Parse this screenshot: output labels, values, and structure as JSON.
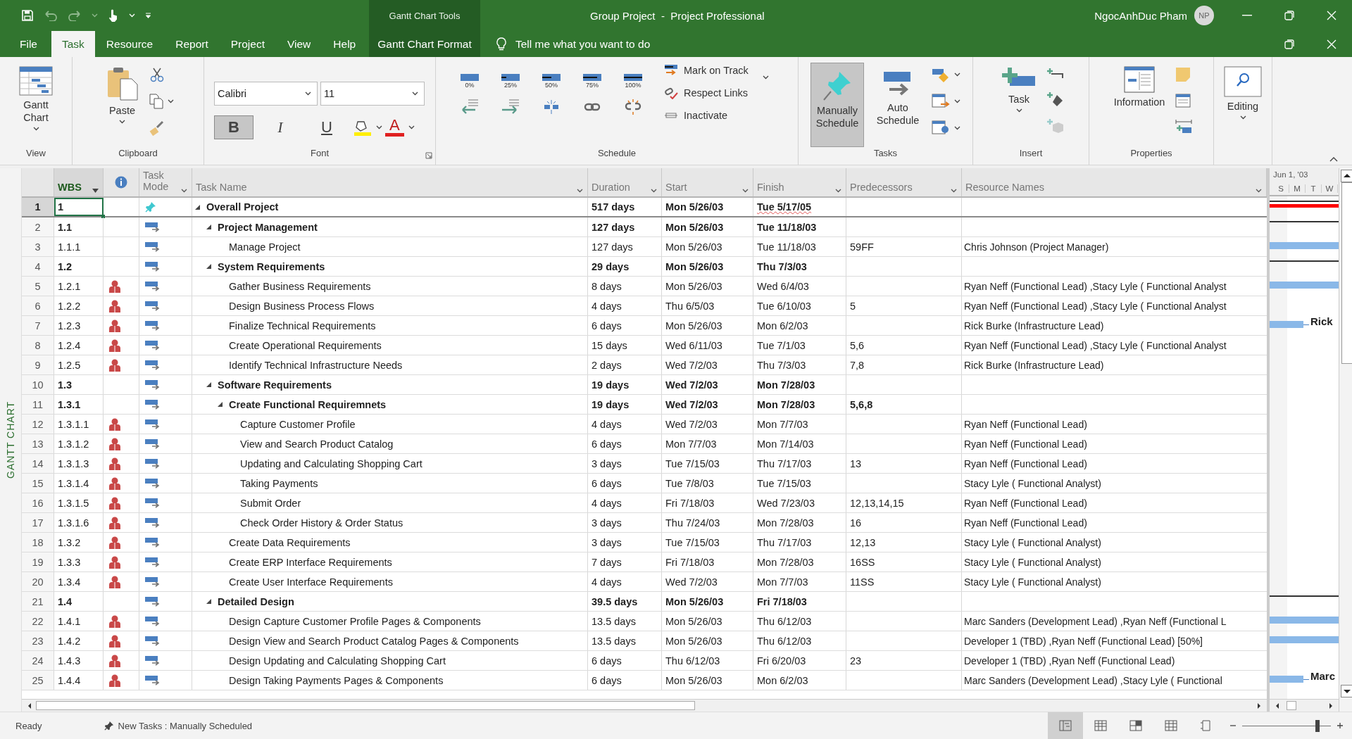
{
  "title_bar": {
    "context_label": "Gantt Chart Tools",
    "title": "Group Project  -  Project Professional",
    "user": "NgocAnhDuc Pham",
    "avatar": "NP"
  },
  "tabs": [
    {
      "label": "File",
      "selected": false,
      "kind": "file"
    },
    {
      "label": "Task",
      "selected": true,
      "kind": "normal"
    },
    {
      "label": "Resource",
      "selected": false,
      "kind": "normal"
    },
    {
      "label": "Report",
      "selected": false,
      "kind": "normal"
    },
    {
      "label": "Project",
      "selected": false,
      "kind": "normal"
    },
    {
      "label": "View",
      "selected": false,
      "kind": "normal"
    },
    {
      "label": "Help",
      "selected": false,
      "kind": "normal"
    },
    {
      "label": "Gantt Chart Format",
      "selected": false,
      "kind": "contextual"
    }
  ],
  "tell_me": {
    "placeholder": "Tell me what you want to do"
  },
  "ribbon": {
    "view_group": {
      "name": "View",
      "button": "Gantt Chart"
    },
    "clipboard_group": {
      "name": "Clipboard",
      "button": "Paste"
    },
    "font_group": {
      "name": "Font",
      "font": "Calibri",
      "size": "11",
      "styles": [
        {
          "label": "B",
          "selected": true
        },
        {
          "label": "I",
          "selected": false
        },
        {
          "label": "U",
          "selected": false
        }
      ],
      "font_color": "A"
    },
    "schedule_group": {
      "name": "Schedule",
      "percent_buttons": [
        "0%",
        "25%",
        "50%",
        "75%",
        "100%"
      ],
      "commands": [
        "Mark on Track",
        "Respect Links",
        "Inactivate"
      ]
    },
    "tasks_group": {
      "name": "Tasks",
      "buttons": [
        {
          "label": "Manually Schedule",
          "selected": true
        },
        {
          "label": "Auto Schedule",
          "selected": false
        }
      ]
    },
    "insert_group": {
      "name": "Insert",
      "button": "Task"
    },
    "properties_group": {
      "name": "Properties",
      "button": "Information"
    },
    "editing_group": {
      "button": "Editing"
    }
  },
  "side_label": "GANTT CHART",
  "table": {
    "columns": [
      {
        "label": "WBS",
        "selected": true
      },
      {
        "label": "Task Mode",
        "selected": false
      },
      {
        "label": "Task Name",
        "selected": false
      },
      {
        "label": "Duration",
        "selected": false
      },
      {
        "label": "Start",
        "selected": false
      },
      {
        "label": "Finish",
        "selected": false
      },
      {
        "label": "Predecessors",
        "selected": false
      },
      {
        "label": "Resource Names",
        "selected": false
      }
    ],
    "rows": [
      {
        "row_number": "1",
        "wbs": "1",
        "name": "Overall Project",
        "duration": "517 days",
        "start": "Mon 5/26/03",
        "finish": "Tue 5/17/05",
        "kind": "manual",
        "assigned": false,
        "selected": true,
        "bar": {
          "kind": "critical_summary"
        },
        "expanded": true,
        "children": [
          {
            "row_number": "2",
            "wbs": "1.1",
            "name": "Project Management",
            "duration": "127 days",
            "start": "Mon 5/26/03",
            "finish": "Tue 11/18/03",
            "kind": "auto",
            "assigned": false,
            "selected": false,
            "bar": {
              "kind": "summary"
            },
            "expanded": true,
            "children": [
              {
                "row_number": "3",
                "wbs": "1.1.1",
                "name": "Manage Project",
                "duration": "127 days",
                "start": "Mon 5/26/03",
                "finish": "Tue 11/18/03",
                "predecessors": "59FF",
                "resources": "Chris Johnson (Project Manager)",
                "kind": "auto",
                "assigned": false,
                "selected": false,
                "bar": {
                  "kind": "task"
                }
              }
            ]
          },
          {
            "row_number": "4",
            "wbs": "1.2",
            "name": "System Requirements",
            "duration": "29 days",
            "start": "Mon 5/26/03",
            "finish": "Thu 7/3/03",
            "kind": "auto",
            "assigned": false,
            "selected": false,
            "bar": {
              "kind": "summary"
            },
            "expanded": true,
            "children": [
              {
                "row_number": "5",
                "wbs": "1.2.1",
                "name": "Gather Business Requirements",
                "duration": "8 days",
                "start": "Mon 5/26/03",
                "finish": "Wed 6/4/03",
                "resources": "Ryan Neff (Functional Lead) ,Stacy Lyle ( Functional Analyst",
                "kind": "auto",
                "assigned": true,
                "selected": false,
                "bar": {
                  "kind": "task"
                }
              },
              {
                "row_number": "6",
                "wbs": "1.2.2",
                "name": "Design Business Process Flows",
                "duration": "4 days",
                "start": "Thu 6/5/03",
                "finish": "Tue 6/10/03",
                "predecessors": "5",
                "resources": "Ryan Neff (Functional Lead) ,Stacy Lyle ( Functional Analyst",
                "kind": "auto",
                "assigned": true,
                "selected": false
              },
              {
                "row_number": "7",
                "wbs": "1.2.3",
                "name": "Finalize Technical Requirements",
                "duration": "6 days",
                "start": "Mon 5/26/03",
                "finish": "Mon 6/2/03",
                "resources": "Rick Burke (Infrastructure Lead)",
                "kind": "auto",
                "assigned": true,
                "selected": false,
                "bar": {
                  "kind": "task_short",
                  "label": "Rick"
                }
              },
              {
                "row_number": "8",
                "wbs": "1.2.4",
                "name": "Create Operational Requirements",
                "duration": "15 days",
                "start": "Wed 6/11/03",
                "finish": "Tue 7/1/03",
                "predecessors": "5,6",
                "resources": "Ryan Neff (Functional Lead) ,Stacy Lyle ( Functional Analyst",
                "kind": "auto",
                "assigned": true,
                "selected": false
              },
              {
                "row_number": "9",
                "wbs": "1.2.5",
                "name": "Identify Technical Infrastructure Needs",
                "duration": "2 days",
                "start": "Wed 7/2/03",
                "finish": "Thu 7/3/03",
                "predecessors": "7,8",
                "resources": "Rick Burke (Infrastructure Lead)",
                "kind": "auto",
                "assigned": true,
                "selected": false
              }
            ]
          },
          {
            "row_number": "10",
            "wbs": "1.3",
            "name": "Software Requirements",
            "duration": "19 days",
            "start": "Wed 7/2/03",
            "finish": "Mon 7/28/03",
            "kind": "auto",
            "assigned": false,
            "selected": false,
            "expanded": true,
            "children": [
              {
                "row_number": "11",
                "wbs": "1.3.1",
                "name": "Create Functional Requiremnets",
                "duration": "19 days",
                "start": "Wed 7/2/03",
                "finish": "Mon 7/28/03",
                "predecessors": "5,6,8",
                "kind": "auto",
                "assigned": false,
                "selected": false,
                "expanded": true,
                "children": [
                  {
                    "row_number": "12",
                    "wbs": "1.3.1.1",
                    "name": "Capture Customer Profile",
                    "duration": "4 days",
                    "start": "Wed 7/2/03",
                    "finish": "Mon 7/7/03",
                    "resources": "Ryan Neff (Functional Lead)",
                    "kind": "auto",
                    "assigned": true,
                    "selected": false
                  },
                  {
                    "row_number": "13",
                    "wbs": "1.3.1.2",
                    "name": "View and Search Product Catalog",
                    "duration": "6 days",
                    "start": "Mon 7/7/03",
                    "finish": "Mon 7/14/03",
                    "resources": "Ryan Neff (Functional Lead)",
                    "kind": "auto",
                    "assigned": true,
                    "selected": false
                  },
                  {
                    "row_number": "14",
                    "wbs": "1.3.1.3",
                    "name": "Updating and Calculating Shopping Cart",
                    "duration": "3 days",
                    "start": "Tue 7/15/03",
                    "finish": "Thu 7/17/03",
                    "predecessors": "13",
                    "resources": "Ryan Neff (Functional Lead)",
                    "kind": "auto",
                    "assigned": true,
                    "selected": false
                  },
                  {
                    "row_number": "15",
                    "wbs": "1.3.1.4",
                    "name": "Taking Payments",
                    "duration": "6 days",
                    "start": "Tue 7/8/03",
                    "finish": "Tue 7/15/03",
                    "resources": "Stacy Lyle ( Functional Analyst)",
                    "kind": "auto",
                    "assigned": true,
                    "selected": false
                  },
                  {
                    "row_number": "16",
                    "wbs": "1.3.1.5",
                    "name": "Submit Order",
                    "duration": "4 days",
                    "start": "Fri 7/18/03",
                    "finish": "Wed 7/23/03",
                    "predecessors": "12,13,14,15",
                    "resources": "Ryan Neff (Functional Lead)",
                    "kind": "auto",
                    "assigned": true,
                    "selected": false
                  },
                  {
                    "row_number": "17",
                    "wbs": "1.3.1.6",
                    "name": "Check Order History & Order Status",
                    "duration": "3 days",
                    "start": "Thu 7/24/03",
                    "finish": "Mon 7/28/03",
                    "predecessors": "16",
                    "resources": "Ryan Neff (Functional Lead)",
                    "kind": "auto",
                    "assigned": true,
                    "selected": false
                  }
                ]
              },
              {
                "row_number": "18",
                "wbs": "1.3.2",
                "name": "Create Data Requirements",
                "duration": "3 days",
                "start": "Tue 7/15/03",
                "finish": "Thu 7/17/03",
                "predecessors": "12,13",
                "resources": "Stacy Lyle ( Functional Analyst)",
                "kind": "auto",
                "assigned": true,
                "selected": false
              },
              {
                "row_number": "19",
                "wbs": "1.3.3",
                "name": "Create ERP Interface Requirements",
                "duration": "7 days",
                "start": "Fri 7/18/03",
                "finish": "Mon 7/28/03",
                "predecessors": "16SS",
                "resources": "Stacy Lyle ( Functional Analyst)",
                "kind": "auto",
                "assigned": true,
                "selected": false
              },
              {
                "row_number": "20",
                "wbs": "1.3.4",
                "name": "Create User Interface Requirements",
                "duration": "4 days",
                "start": "Wed 7/2/03",
                "finish": "Mon 7/7/03",
                "predecessors": "11SS",
                "resources": "Stacy Lyle ( Functional Analyst)",
                "kind": "auto",
                "assigned": true,
                "selected": false
              }
            ]
          },
          {
            "row_number": "21",
            "wbs": "1.4",
            "name": "Detailed Design",
            "duration": "39.5 days",
            "start": "Mon 5/26/03",
            "finish": "Fri 7/18/03",
            "kind": "auto",
            "assigned": false,
            "selected": false,
            "bar": {
              "kind": "summary"
            },
            "expanded": true,
            "children": [
              {
                "row_number": "22",
                "wbs": "1.4.1",
                "name": "Design Capture Customer Profile Pages & Components",
                "duration": "13.5 days",
                "start": "Mon 5/26/03",
                "finish": "Thu 6/12/03",
                "resources": "Marc Sanders (Development Lead) ,Ryan Neff (Functional L",
                "kind": "auto",
                "assigned": true,
                "selected": false,
                "bar": {
                  "kind": "task"
                }
              },
              {
                "row_number": "23",
                "wbs": "1.4.2",
                "name": "Design View and Search Product Catalog Pages & Components",
                "duration": "13.5 days",
                "start": "Mon 5/26/03",
                "finish": "Thu 6/12/03",
                "resources": "Developer 1 (TBD) ,Ryan Neff (Functional Lead) [50%]",
                "kind": "auto",
                "assigned": true,
                "selected": false,
                "bar": {
                  "kind": "task"
                }
              },
              {
                "row_number": "24",
                "wbs": "1.4.3",
                "name": "Design Updating and Calculating Shopping Cart",
                "duration": "6 days",
                "start": "Thu 6/12/03",
                "finish": "Fri 6/20/03",
                "predecessors": "23",
                "resources": "Developer 1 (TBD) ,Ryan Neff (Functional Lead)",
                "kind": "auto",
                "assigned": true,
                "selected": false
              },
              {
                "row_number": "25",
                "wbs": "1.4.4",
                "name": "Design Taking Payments Pages & Components",
                "duration": "6 days",
                "start": "Mon 5/26/03",
                "finish": "Mon 6/2/03",
                "resources": "Marc Sanders (Development Lead) ,Stacy Lyle ( Functional",
                "kind": "auto",
                "assigned": true,
                "selected": false,
                "bar": {
                  "kind": "task_short",
                  "label": "Marc"
                }
              }
            ]
          }
        ]
      }
    ]
  },
  "timescale": {
    "label": "Jun 1, '03",
    "days": [
      "S",
      "M",
      "T",
      "W"
    ]
  },
  "status_bar": {
    "status": "Ready",
    "new_tasks": "New Tasks : Manually Scheduled",
    "views": [
      {
        "selected": true
      },
      {
        "selected": false
      },
      {
        "selected": false
      },
      {
        "selected": false
      },
      {
        "selected": false
      }
    ],
    "zoom": {
      "level": 0.85
    }
  }
}
